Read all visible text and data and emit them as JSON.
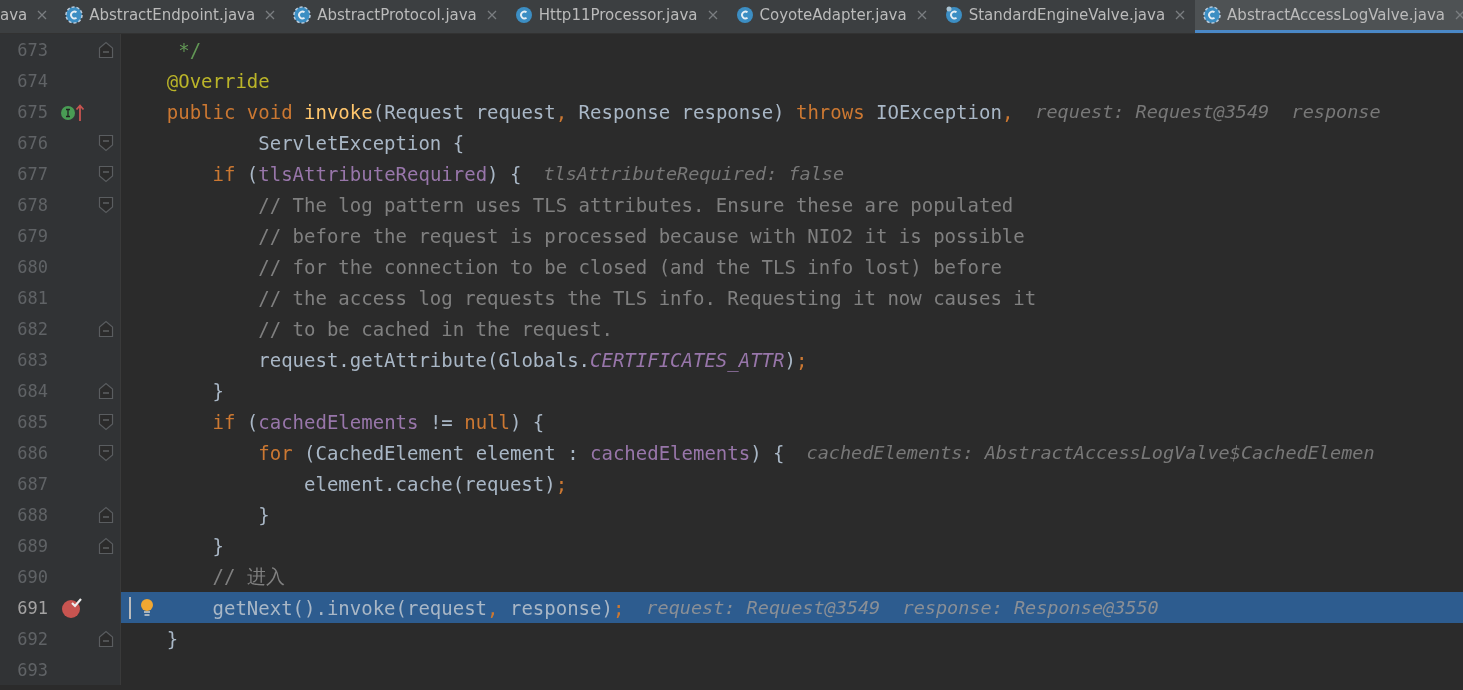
{
  "tabs": [
    {
      "label": "ava",
      "selected": false
    },
    {
      "label": "AbstractEndpoint.java",
      "kind": "abstract",
      "selected": false
    },
    {
      "label": "AbstractProtocol.java",
      "kind": "abstract",
      "selected": false
    },
    {
      "label": "Http11Processor.java",
      "kind": "class",
      "selected": false
    },
    {
      "label": "CoyoteAdapter.java",
      "kind": "class",
      "selected": false
    },
    {
      "label": "StandardEngineValve.java",
      "kind": "final",
      "selected": false
    },
    {
      "label": "AbstractAccessLogValve.java",
      "kind": "abstract",
      "selected": true
    }
  ],
  "lines": [
    {
      "number": "673",
      "fold_end": true,
      "tokens": [
        {
          "kind": "doc",
          "text": "     */"
        }
      ]
    },
    {
      "number": "674",
      "tokens": [
        {
          "kind": "annot",
          "text": "    @Override"
        }
      ]
    },
    {
      "number": "675",
      "implements": true,
      "tokens": [
        {
          "kind": "kw",
          "text": "    public void "
        },
        {
          "kind": "method",
          "text": "invoke"
        },
        {
          "kind": "plain",
          "text": "(Request request"
        },
        {
          "kind": "punct",
          "text": ", "
        },
        {
          "kind": "plain",
          "text": "Response response) "
        },
        {
          "kind": "kw",
          "text": "throws "
        },
        {
          "kind": "plain",
          "text": "IOException"
        },
        {
          "kind": "punct",
          "text": ","
        }
      ],
      "hint": "request: Request@3549  response"
    },
    {
      "number": "676",
      "fold_start": true,
      "tokens": [
        {
          "kind": "plain",
          "text": "            ServletException {"
        }
      ]
    },
    {
      "number": "677",
      "fold_start": true,
      "tokens": [
        {
          "kind": "kw",
          "text": "        if "
        },
        {
          "kind": "plain",
          "text": "("
        },
        {
          "kind": "field",
          "text": "tlsAttributeRequired"
        },
        {
          "kind": "plain",
          "text": ") {"
        }
      ],
      "hint": "tlsAttributeRequired: false"
    },
    {
      "number": "678",
      "fold_start": true,
      "tokens": [
        {
          "kind": "comment",
          "text": "            // The log pattern uses TLS attributes. Ensure these are populated"
        }
      ]
    },
    {
      "number": "679",
      "tokens": [
        {
          "kind": "comment",
          "text": "            // before the request is processed because with NIO2 it is possible"
        }
      ]
    },
    {
      "number": "680",
      "tokens": [
        {
          "kind": "comment",
          "text": "            // for the connection to be closed (and the TLS info lost) before"
        }
      ]
    },
    {
      "number": "681",
      "tokens": [
        {
          "kind": "comment",
          "text": "            // the access log requests the TLS info. Requesting it now causes it"
        }
      ]
    },
    {
      "number": "682",
      "fold_end": true,
      "tokens": [
        {
          "kind": "comment",
          "text": "            // to be cached in the request."
        }
      ]
    },
    {
      "number": "683",
      "tokens": [
        {
          "kind": "plain",
          "text": "            request.getAttribute(Globals."
        },
        {
          "kind": "static",
          "text": "CERTIFICATES_ATTR"
        },
        {
          "kind": "plain",
          "text": ")"
        },
        {
          "kind": "punct",
          "text": ";"
        }
      ]
    },
    {
      "number": "684",
      "fold_end": true,
      "tokens": [
        {
          "kind": "plain",
          "text": "        }"
        }
      ]
    },
    {
      "number": "685",
      "fold_start": true,
      "tokens": [
        {
          "kind": "kw",
          "text": "        if "
        },
        {
          "kind": "plain",
          "text": "("
        },
        {
          "kind": "field",
          "text": "cachedElements"
        },
        {
          "kind": "plain",
          "text": " != "
        },
        {
          "kind": "kw",
          "text": "null"
        },
        {
          "kind": "plain",
          "text": ") {"
        }
      ]
    },
    {
      "number": "686",
      "fold_start": true,
      "tokens": [
        {
          "kind": "kw",
          "text": "            for "
        },
        {
          "kind": "plain",
          "text": "(CachedElement element : "
        },
        {
          "kind": "field",
          "text": "cachedElements"
        },
        {
          "kind": "plain",
          "text": ") {"
        }
      ],
      "hint": "cachedElements: AbstractAccessLogValve$CachedElemen"
    },
    {
      "number": "687",
      "tokens": [
        {
          "kind": "plain",
          "text": "                element.cache(request)"
        },
        {
          "kind": "punct",
          "text": ";"
        }
      ]
    },
    {
      "number": "688",
      "fold_end": true,
      "tokens": [
        {
          "kind": "plain",
          "text": "            }"
        }
      ]
    },
    {
      "number": "689",
      "fold_end": true,
      "tokens": [
        {
          "kind": "plain",
          "text": "        }"
        }
      ]
    },
    {
      "number": "690",
      "tokens": [
        {
          "kind": "comment",
          "text": "        // 进入"
        }
      ]
    },
    {
      "number": "691",
      "selected": true,
      "breakpoint": true,
      "bulb": true,
      "tokens": [
        {
          "kind": "plain",
          "text": "        getNext().invoke(request"
        },
        {
          "kind": "punct",
          "text": ", "
        },
        {
          "kind": "plain",
          "text": "response)"
        },
        {
          "kind": "punct",
          "text": ";"
        }
      ],
      "hint": "request: Request@3549  response: Response@3550"
    },
    {
      "number": "692",
      "fold_end": true,
      "tokens": [
        {
          "kind": "plain",
          "text": "    }"
        }
      ]
    },
    {
      "number": "693"
    }
  ]
}
